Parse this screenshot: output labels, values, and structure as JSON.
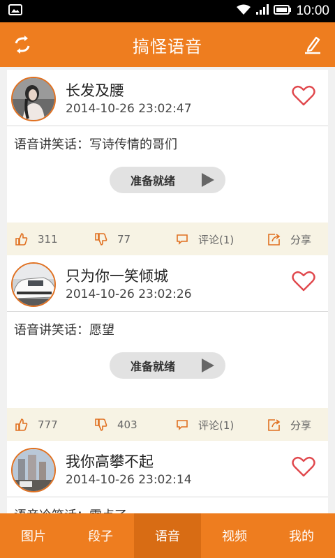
{
  "status_bar": {
    "time": "10:00"
  },
  "header": {
    "title": "搞怪语音"
  },
  "posts": [
    {
      "username": "长发及腰",
      "time": "2014-10-26 23:02:47",
      "text": "语音讲笑话：写诗传情的哥们",
      "play_label": "准备就绪",
      "likes": "311",
      "dislikes": "77",
      "comments": "评论(1)",
      "share": "分享"
    },
    {
      "username": "只为你一笑倾城",
      "time": "2014-10-26 23:02:26",
      "text": "语音讲笑话：愿望",
      "play_label": "准备就绪",
      "likes": "777",
      "dislikes": "403",
      "comments": "评论(1)",
      "share": "分享"
    },
    {
      "username": "我你高攀不起",
      "time": "2014-10-26 23:02:14",
      "text": "语音冷笑话：雷点了"
    }
  ],
  "bottom_nav": {
    "items": [
      "图片",
      "段子",
      "语音",
      "视频",
      "我的"
    ],
    "active": "语音"
  },
  "colors": {
    "accent": "#ee7d1f",
    "heart": "#e0474c"
  }
}
